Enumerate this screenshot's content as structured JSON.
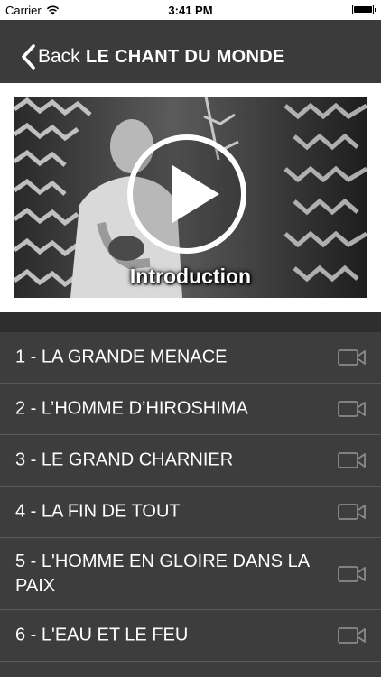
{
  "status_bar": {
    "carrier": "Carrier",
    "time": "3:41 PM",
    "battery_level": 1.0
  },
  "nav": {
    "back_label": "Back",
    "title": "LE CHANT DU MONDE"
  },
  "hero": {
    "caption": "Introduction",
    "play_icon": "play-icon"
  },
  "chapters": [
    {
      "label": "1 - LA GRANDE MENACE",
      "icon": "video-camera-icon"
    },
    {
      "label": "2 - L’HOMME D’HIROSHIMA",
      "icon": "video-camera-icon"
    },
    {
      "label": "3 - LE GRAND CHARNIER",
      "icon": "video-camera-icon"
    },
    {
      "label": "4 - LA FIN DE TOUT",
      "icon": "video-camera-icon"
    },
    {
      "label": "5 - L'HOMME EN GLOIRE DANS LA PAIX",
      "icon": "video-camera-icon"
    },
    {
      "label": "6 - L'EAU ET LE FEU",
      "icon": "video-camera-icon"
    }
  ],
  "colors": {
    "nav_background": "#3b3b3b",
    "list_background": "#3d3d3d",
    "text": "#ffffff",
    "separator": "#5a5a5a",
    "icon": "#8a8a8a"
  }
}
